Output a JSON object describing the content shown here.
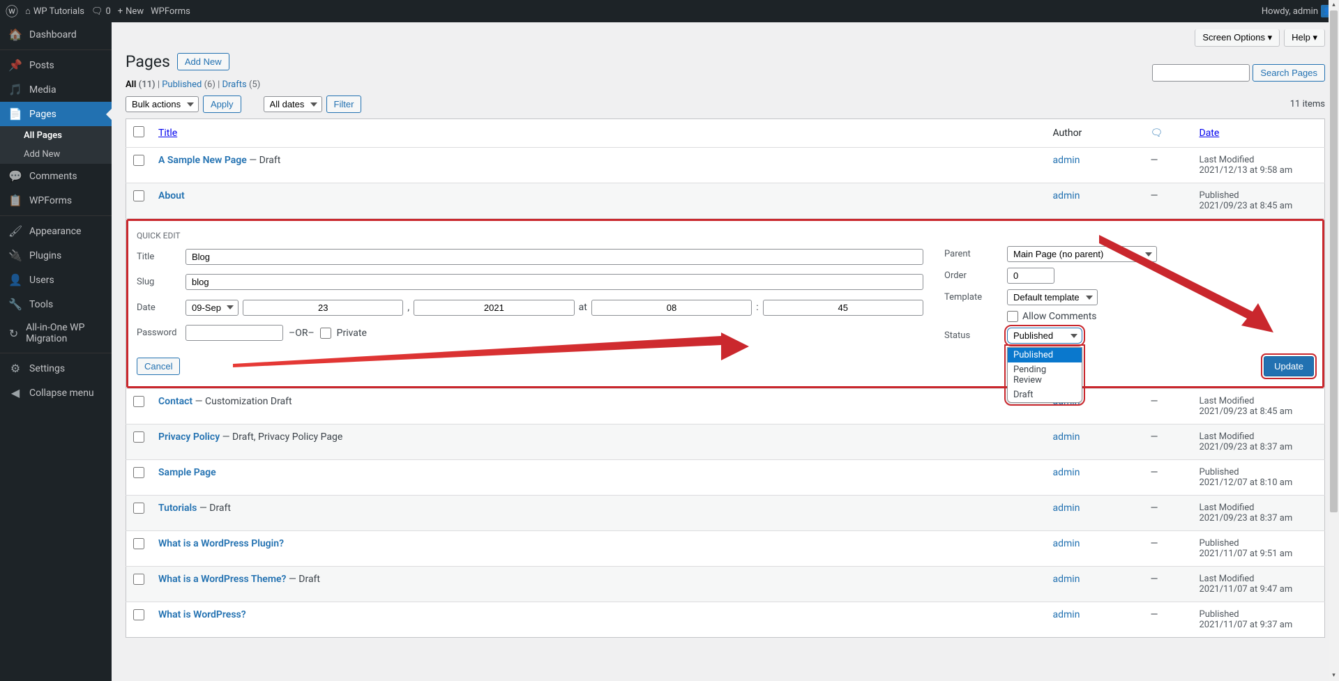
{
  "toolbar": {
    "site_name": "WP Tutorials",
    "comments_count": "0",
    "new_label": "New",
    "wpforms_label": "WPForms",
    "howdy": "Howdy, admin"
  },
  "menu": {
    "dashboard": "Dashboard",
    "posts": "Posts",
    "media": "Media",
    "pages": "Pages",
    "all_pages": "All Pages",
    "add_new": "Add New",
    "comments": "Comments",
    "wpforms": "WPForms",
    "appearance": "Appearance",
    "plugins": "Plugins",
    "users": "Users",
    "tools": "Tools",
    "migration": "All-in-One WP Migration",
    "settings": "Settings",
    "collapse": "Collapse menu"
  },
  "header": {
    "title": "Pages",
    "add_new": "Add New",
    "screen_options": "Screen Options",
    "help": "Help",
    "search_button": "Search Pages"
  },
  "filters": {
    "all_label": "All",
    "all_count": "(11)",
    "published_label": "Published",
    "published_count": "(6)",
    "drafts_label": "Drafts",
    "drafts_count": "(5)",
    "bulk_actions": "Bulk actions",
    "apply": "Apply",
    "all_dates": "All dates",
    "filter": "Filter",
    "items_count": "11 items"
  },
  "columns": {
    "title": "Title",
    "author": "Author",
    "date": "Date"
  },
  "quick_edit": {
    "heading": "QUICK EDIT",
    "labels": {
      "title": "Title",
      "slug": "Slug",
      "date": "Date",
      "password": "Password",
      "parent": "Parent",
      "order": "Order",
      "template": "Template",
      "allow_comments": "Allow Comments",
      "status": "Status",
      "or": "–OR–",
      "private": "Private",
      "at": "at"
    },
    "title": "Blog",
    "slug": "blog",
    "month": "09-Sep",
    "day": "23",
    "year": "2021",
    "hour": "08",
    "minute": "45",
    "parent": "Main Page (no parent)",
    "order": "0",
    "template": "Default template",
    "status": "Published",
    "status_options": [
      "Published",
      "Pending Review",
      "Draft"
    ],
    "cancel": "Cancel",
    "update": "Update"
  },
  "rows": [
    {
      "title": "A Sample New Page",
      "suffix": " — Draft",
      "author": "admin",
      "comments": "—",
      "status": "Last Modified",
      "date": "2021/12/13 at 9:58 am"
    },
    {
      "title": "About",
      "suffix": "",
      "author": "admin",
      "comments": "—",
      "status": "Published",
      "date": "2021/09/23 at 8:45 am"
    },
    {
      "title": "Contact",
      "suffix": " — Customization Draft",
      "author": "admin",
      "comments": "—",
      "status": "Last Modified",
      "date": "2021/09/23 at 8:45 am"
    },
    {
      "title": "Privacy Policy",
      "suffix": " — Draft, Privacy Policy Page",
      "author": "admin",
      "comments": "—",
      "status": "Last Modified",
      "date": "2021/09/23 at 8:37 am"
    },
    {
      "title": "Sample Page",
      "suffix": "",
      "author": "admin",
      "comments": "—",
      "status": "Published",
      "date": "2021/12/07 at 8:10 am"
    },
    {
      "title": "Tutorials",
      "suffix": " — Draft",
      "author": "admin",
      "comments": "—",
      "status": "Last Modified",
      "date": "2021/09/23 at 8:37 am"
    },
    {
      "title": "What is a WordPress Plugin?",
      "suffix": "",
      "author": "admin",
      "comments": "—",
      "status": "Published",
      "date": "2021/11/07 at 9:51 am"
    },
    {
      "title": "What is a WordPress Theme?",
      "suffix": " — Draft",
      "author": "admin",
      "comments": "—",
      "status": "Last Modified",
      "date": "2021/11/07 at 9:47 am"
    },
    {
      "title": "What is WordPress?",
      "suffix": "",
      "author": "admin",
      "comments": "—",
      "status": "Published",
      "date": "2021/11/07 at 9:37 am"
    }
  ]
}
